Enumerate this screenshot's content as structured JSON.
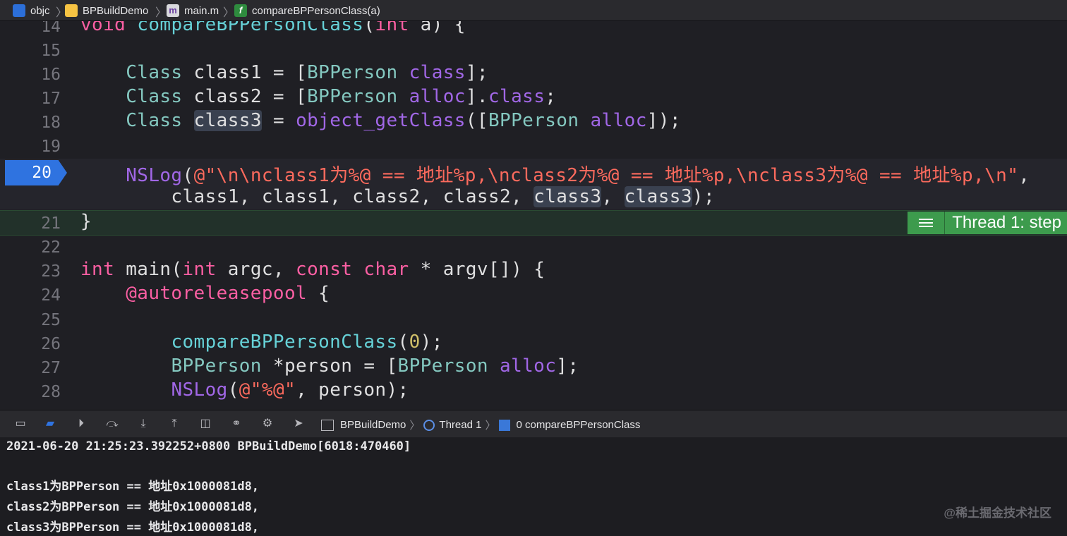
{
  "jumpbar": {
    "crumbs": [
      "objc",
      "BPBuildDemo",
      "main.m",
      "compareBPPersonClass(a)"
    ]
  },
  "editor": {
    "line_numbers": [
      "14",
      "15",
      "16",
      "17",
      "18",
      "19",
      "20",
      "21",
      "22",
      "23",
      "24",
      "25",
      "26",
      "27",
      "28"
    ],
    "breakpoint_line": "20",
    "step_label": "Thread 1: step"
  },
  "debugbar": {
    "path": [
      "BPBuildDemo",
      "Thread 1",
      "0 compareBPPersonClass"
    ]
  },
  "console": {
    "lines": [
      "2021-06-20 21:25:23.392252+0800 BPBuildDemo[6018:470460]",
      "",
      "class1为BPPerson == 地址0x1000081d8,",
      "class2为BPPerson == 地址0x1000081d8,",
      "class3为BPPerson == 地址0x1000081d8,"
    ]
  },
  "watermark": "@稀土掘金技术社区",
  "colors": {
    "keyword": "#fc5fa3",
    "type": "#84c8c0",
    "function": "#a167e6",
    "string": "#fc6a5d",
    "number": "#d0bf69",
    "breakpoint": "#2f73e0",
    "step_badge": "#3d9b4d"
  }
}
